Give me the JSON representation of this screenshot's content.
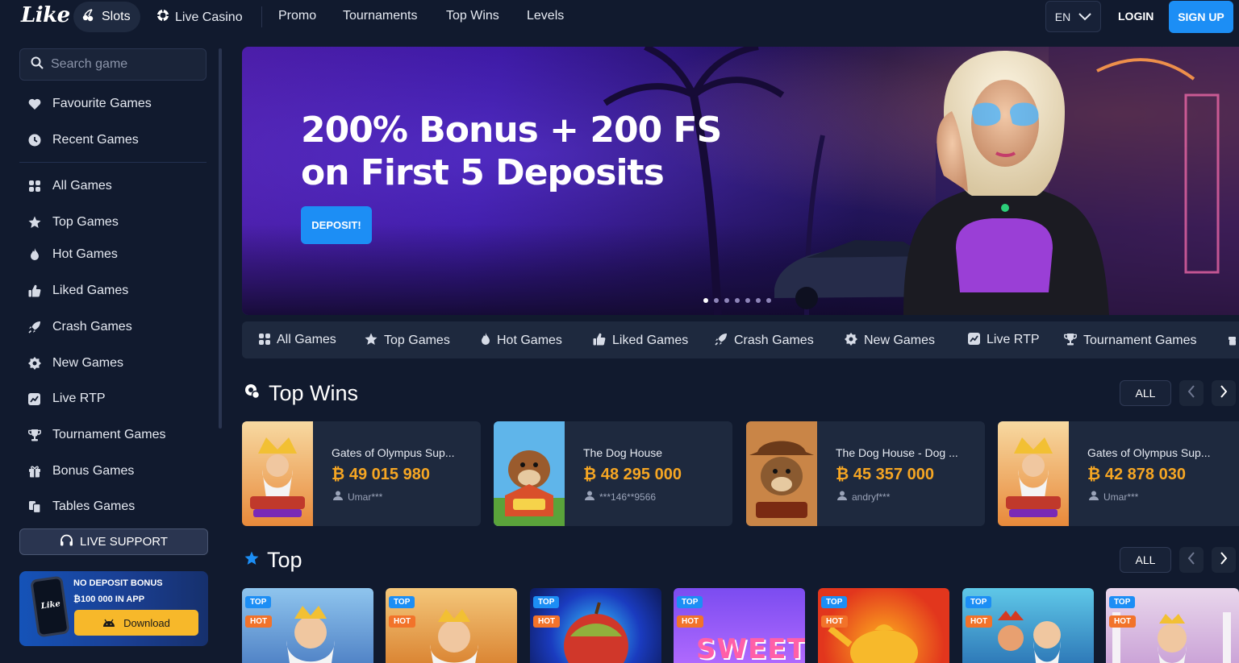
{
  "brand": {
    "logo_text": "Like"
  },
  "topnav": {
    "items": [
      {
        "label": "Slots",
        "icon": "cherries-icon"
      },
      {
        "label": "Live Casino",
        "icon": "chip-icon"
      },
      {
        "label": "Promo"
      },
      {
        "label": "Tournaments"
      },
      {
        "label": "Top Wins"
      },
      {
        "label": "Levels"
      }
    ],
    "language": "EN",
    "login_label": "LOGIN",
    "signup_label": "SIGN UP"
  },
  "sidebar": {
    "search_placeholder": "Search game",
    "favourites": [
      {
        "label": "Favourite Games",
        "icon": "heart-icon"
      },
      {
        "label": "Recent Games",
        "icon": "clock-icon"
      }
    ],
    "items": [
      {
        "label": "All Games",
        "icon": "grid-icon"
      },
      {
        "label": "Top Games",
        "icon": "star-icon"
      },
      {
        "label": "Hot Games",
        "icon": "fire-icon"
      },
      {
        "label": "Liked Games",
        "icon": "thumbs-up-icon"
      },
      {
        "label": "Crash Games",
        "icon": "rocket-icon"
      },
      {
        "label": "New Games",
        "icon": "new-badge-icon"
      },
      {
        "label": "Live RTP",
        "icon": "chart-icon"
      },
      {
        "label": "Tournament Games",
        "icon": "trophy-icon"
      },
      {
        "label": "Bonus Games",
        "icon": "gift-icon"
      },
      {
        "label": "Tables Games",
        "icon": "cards-icon"
      }
    ],
    "live_support_label": "LIVE SUPPORT",
    "promo": {
      "title": "NO DEPOSIT BONUS",
      "subtitle": "₿100 000 IN APP",
      "download_label": "Download",
      "phone_logo": "Like"
    }
  },
  "hero": {
    "title_line1": "200% Bonus + 200 FS",
    "title_line2": "on First 5 Deposits",
    "cta_label": "DEPOSIT!",
    "slides_total": 7,
    "active_slide": 0
  },
  "categories": [
    {
      "label": "All Games",
      "icon": "grid-icon"
    },
    {
      "label": "Top Games",
      "icon": "star-icon"
    },
    {
      "label": "Hot Games",
      "icon": "fire-icon"
    },
    {
      "label": "Liked Games",
      "icon": "thumbs-up-icon"
    },
    {
      "label": "Crash Games",
      "icon": "rocket-icon"
    },
    {
      "label": "New Games",
      "icon": "new-badge-icon"
    },
    {
      "label": "Live RTP",
      "icon": "chart-icon"
    },
    {
      "label": "Tournament Games",
      "icon": "trophy-icon"
    }
  ],
  "top_wins": {
    "title": "Top Wins",
    "all_label": "ALL",
    "items": [
      {
        "game": "Gates of Olympus Sup...",
        "amount": "₿ 49 015 980",
        "user": "Umar***"
      },
      {
        "game": "The Dog House",
        "amount": "₿ 48 295 000",
        "user": "***146**9566"
      },
      {
        "game": "The Dog House - Dog ...",
        "amount": "₿ 45 357 000",
        "user": "andryf***"
      },
      {
        "game": "Gates of Olympus Sup...",
        "amount": "₿ 42 878 030",
        "user": "Umar***"
      }
    ]
  },
  "top_games": {
    "title": "Top",
    "all_label": "ALL",
    "badge_top": "TOP",
    "badge_hot": "HOT",
    "items": [
      {
        "theme": "zeus-blue"
      },
      {
        "theme": "zeus-gold"
      },
      {
        "theme": "apple"
      },
      {
        "theme": "sweet",
        "visible_text": "SWEET"
      },
      {
        "theme": "teapot"
      },
      {
        "theme": "zeus-vs-hades"
      },
      {
        "theme": "zeus-temple"
      }
    ]
  },
  "colors": {
    "background": "#111a2e",
    "accent": "#1c8ef5",
    "win_amount": "#f6a623",
    "hot_badge": "#f2732a",
    "download": "#f7b82a"
  }
}
